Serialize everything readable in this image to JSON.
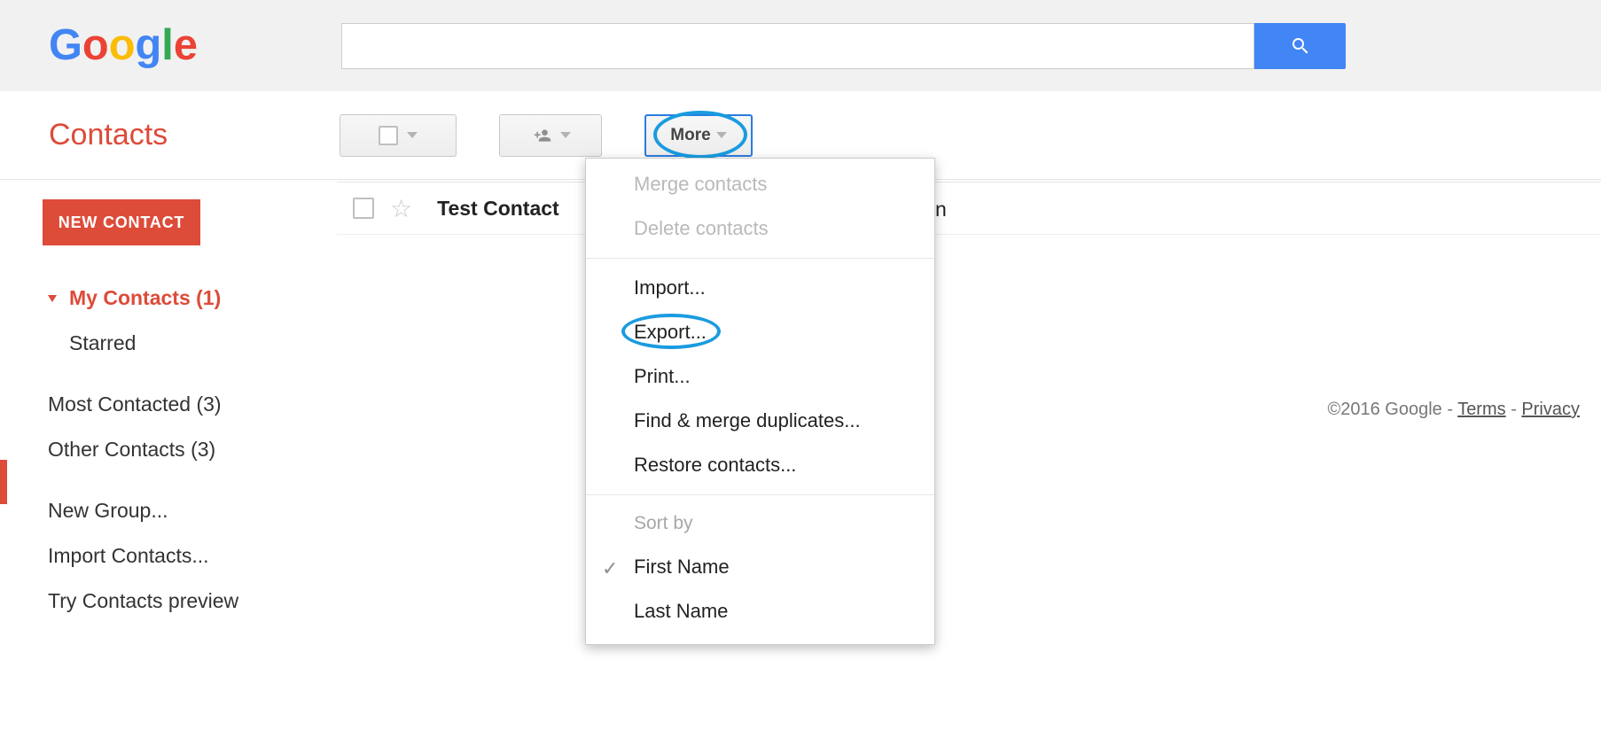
{
  "header": {
    "logo_letters": [
      "G",
      "o",
      "o",
      "g",
      "l",
      "e"
    ],
    "search_value": ""
  },
  "app_title": "Contacts",
  "toolbar": {
    "more_label": "More"
  },
  "new_contact_label": "NEW CONTACT",
  "sidebar": {
    "my_contacts": "My Contacts (1)",
    "starred": "Starred",
    "most_contacted": "Most Contacted (3)",
    "other_contacts": "Other Contacts (3)",
    "new_group": "New Group...",
    "import_contacts": "Import Contacts...",
    "try_preview": "Try Contacts preview"
  },
  "contact": {
    "name": "Test Contact",
    "email_tail": "n"
  },
  "menu": {
    "merge": "Merge contacts",
    "delete": "Delete contacts",
    "import": "Import...",
    "export": "Export...",
    "print": "Print...",
    "find_merge": "Find & merge duplicates...",
    "restore": "Restore contacts...",
    "sort_by": "Sort by",
    "first_name": "First Name",
    "last_name": "Last Name"
  },
  "footer": {
    "copyright": "©2016 Google",
    "terms": "Terms",
    "privacy": "Privacy"
  }
}
